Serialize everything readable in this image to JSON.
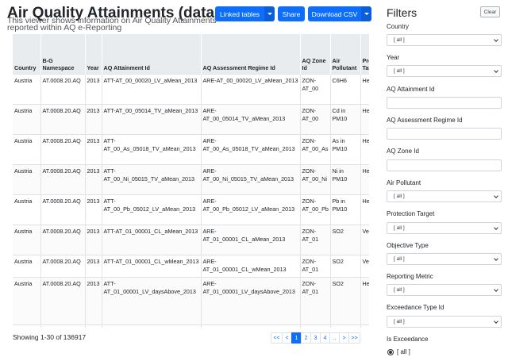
{
  "header": {
    "title": "Air Quality Attainments (data flow G)",
    "subtitle": "This viewer shows information on Air Quality Attainments reported within AQ e-Reporting"
  },
  "toolbar": {
    "linked_tables_label": "Linked tables",
    "share_label": "Share",
    "download_label": "Download CSV"
  },
  "table": {
    "columns": [
      "Country",
      "B-G Namespace",
      "Year",
      "AQ Attainment Id",
      "AQ Assessment Regime Id",
      "AQ Zone Id",
      "Air Pollutant",
      "Protection Target"
    ],
    "rows": [
      [
        "Austria",
        "AT.0008.20.AQ",
        "2013",
        "ATT-AT_00_00020_LV_aMean_2013",
        "ARE-AT_00_00020_LV_aMean_2013",
        "ZON-AT_00",
        "C6H6",
        "Health"
      ],
      [
        "Austria",
        "AT.0008.20.AQ",
        "2013",
        "ATT-AT_00_05014_TV_aMean_2013",
        "ARE-AT_00_05014_TV_aMean_2013",
        "ZON-AT_00",
        "Cd in PM10",
        "Health"
      ],
      [
        "Austria",
        "AT.0008.20.AQ",
        "2013",
        "ATT-AT_00_As_05018_TV_aMean_2013",
        "ARE-AT_00_As_05018_TV_aMean_2013",
        "ZON-AT_00_As",
        "As in PM10",
        "Health"
      ],
      [
        "Austria",
        "AT.0008.20.AQ",
        "2013",
        "ATT-AT_00_Ni_05015_TV_aMean_2013",
        "ARE-AT_00_Ni_05015_TV_aMean_2013",
        "ZON-AT_00_Ni",
        "Ni in PM10",
        "Health"
      ],
      [
        "Austria",
        "AT.0008.20.AQ",
        "2013",
        "ATT-AT_00_Pb_05012_LV_aMean_2013",
        "ARE-AT_00_Pb_05012_LV_aMean_2013",
        "ZON-AT_00_Pb",
        "Pb in PM10",
        "Health"
      ],
      [
        "Austria",
        "AT.0008.20.AQ",
        "2013",
        "ATT-AT_01_00001_CL_aMean_2013",
        "ARE-AT_01_00001_CL_aMean_2013",
        "ZON-AT_01",
        "SO2",
        "Vegetation"
      ],
      [
        "Austria",
        "AT.0008.20.AQ",
        "2013",
        "ATT-AT_01_00001_CL_wMean_2013",
        "ARE-AT_01_00001_CL_wMean_2013",
        "ZON-AT_01",
        "SO2",
        "Vegetation"
      ],
      [
        "Austria",
        "AT.0008.20.AQ",
        "2013",
        "ATT-AT_01_00001_LV_daysAbove_2013",
        "ARE-AT_01_00001_LV_daysAbove_2013",
        "ZON-AT_01",
        "SO2",
        "Health"
      ],
      [
        "Austria",
        "AT.0008.20.AQ",
        "2013",
        "ATT-",
        "ARE-",
        "ZON-",
        "SO2",
        "Health"
      ]
    ]
  },
  "footer": {
    "showing": "Showing 1-30 of 136917",
    "pages": [
      "<<",
      "<",
      "1",
      "2",
      "3",
      "4",
      "..",
      ">",
      ">>"
    ],
    "active_page": "1"
  },
  "filters": {
    "title": "Filters",
    "clear_label": "Clear",
    "country": {
      "label": "Country",
      "value": "[ all ]"
    },
    "year": {
      "label": "Year",
      "value": "[ all ]"
    },
    "attainment_id": {
      "label": "AQ Attainment Id",
      "value": ""
    },
    "regime_id": {
      "label": "AQ Assessment Regime Id",
      "value": ""
    },
    "zone_id": {
      "label": "AQ Zone Id",
      "value": ""
    },
    "pollutant": {
      "label": "Air Pollutant",
      "value": "[ all ]"
    },
    "protection": {
      "label": "Protection Target",
      "value": "[ all ]"
    },
    "objective": {
      "label": "Objective Type",
      "value": "[ all ]"
    },
    "metric": {
      "label": "Reporting Metric",
      "value": "[ all ]"
    },
    "exceedance_type": {
      "label": "Exceedance Type Id",
      "value": "[ all ]"
    },
    "is_exceedance": {
      "label": "Is Exceedance",
      "option": "[ all ]"
    }
  },
  "colors": {
    "accent": "#0d6efd",
    "header_bg": "#e9ecef"
  }
}
